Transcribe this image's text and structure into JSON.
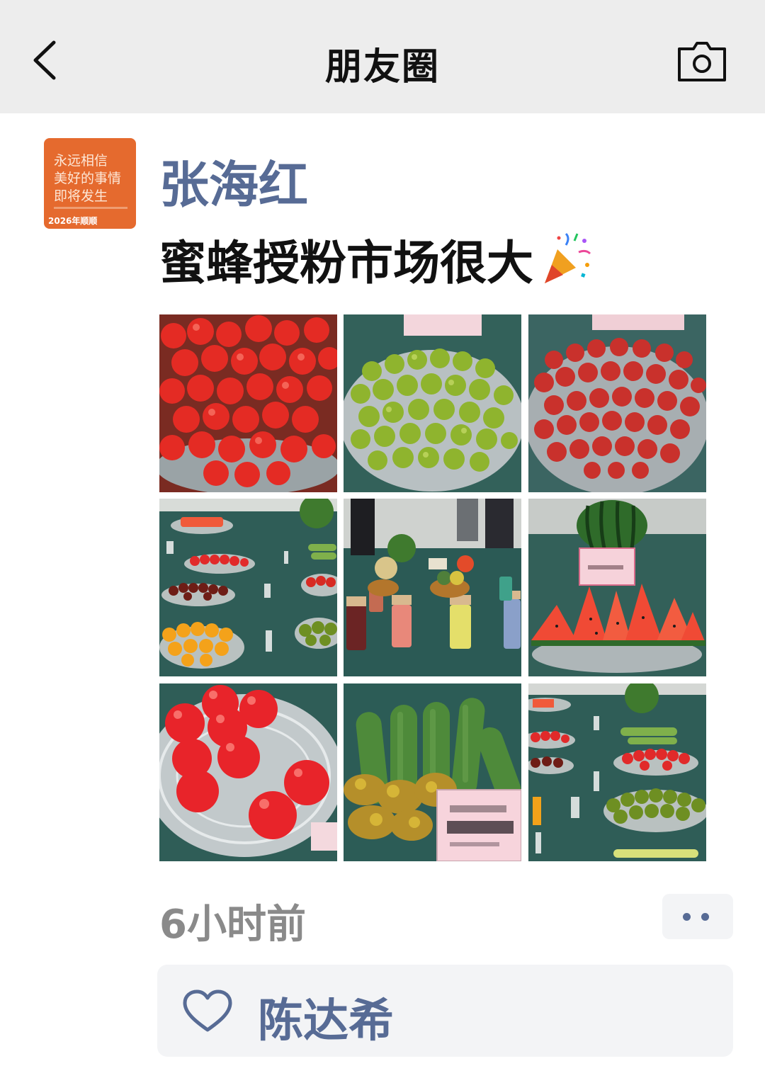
{
  "header": {
    "title": "朋友圈"
  },
  "post": {
    "avatar_lines": [
      "永远相信",
      "美好的事情",
      "即将发生"
    ],
    "avatar_footer": "2026年顺顺",
    "author": "张海红",
    "text": "蜜蜂授粉市场很大",
    "emoji": "party-popper",
    "photos": [
      "red-cherry-tomatoes",
      "green-cherry-tomatoes",
      "dark-red-cherry-tomatoes",
      "produce-exhibition-table",
      "seed-jars-and-melons",
      "sliced-watermelon",
      "red-tomatoes-on-glass-plate",
      "cucumbers-with-sign",
      "produce-display-plates"
    ],
    "time": "6小时前",
    "likes": [
      "陈达希"
    ]
  },
  "colors": {
    "link": "#576b95",
    "header_bg": "#ededed",
    "panel_bg": "#f3f4f6"
  }
}
